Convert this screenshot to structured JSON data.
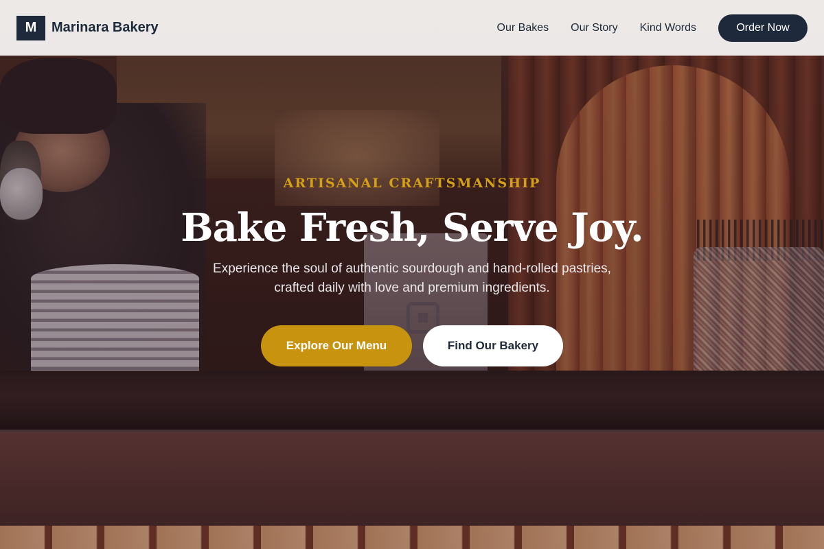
{
  "colors": {
    "brand_dark": "#1e293b",
    "accent_gold": "#c8940f",
    "eyebrow_gold": "#d4a017",
    "header_bg": "#f6f3f2"
  },
  "header": {
    "logo_letter": "M",
    "brand_name": "Marinara Bakery",
    "nav": [
      {
        "label": "Our Bakes"
      },
      {
        "label": "Our Story"
      },
      {
        "label": "Kind Words"
      }
    ],
    "order_button": "Order Now"
  },
  "hero": {
    "eyebrow": "ARTISANAL CRAFTSMANSHIP",
    "headline": "Bake Fresh, Serve Joy.",
    "subtext_line1": "Experience the soul of authentic sourdough and hand-rolled pastries,",
    "subtext_line2": "crafted daily with love and premium ingredients.",
    "primary_cta": "Explore Our Menu",
    "secondary_cta": "Find Our Bakery"
  }
}
